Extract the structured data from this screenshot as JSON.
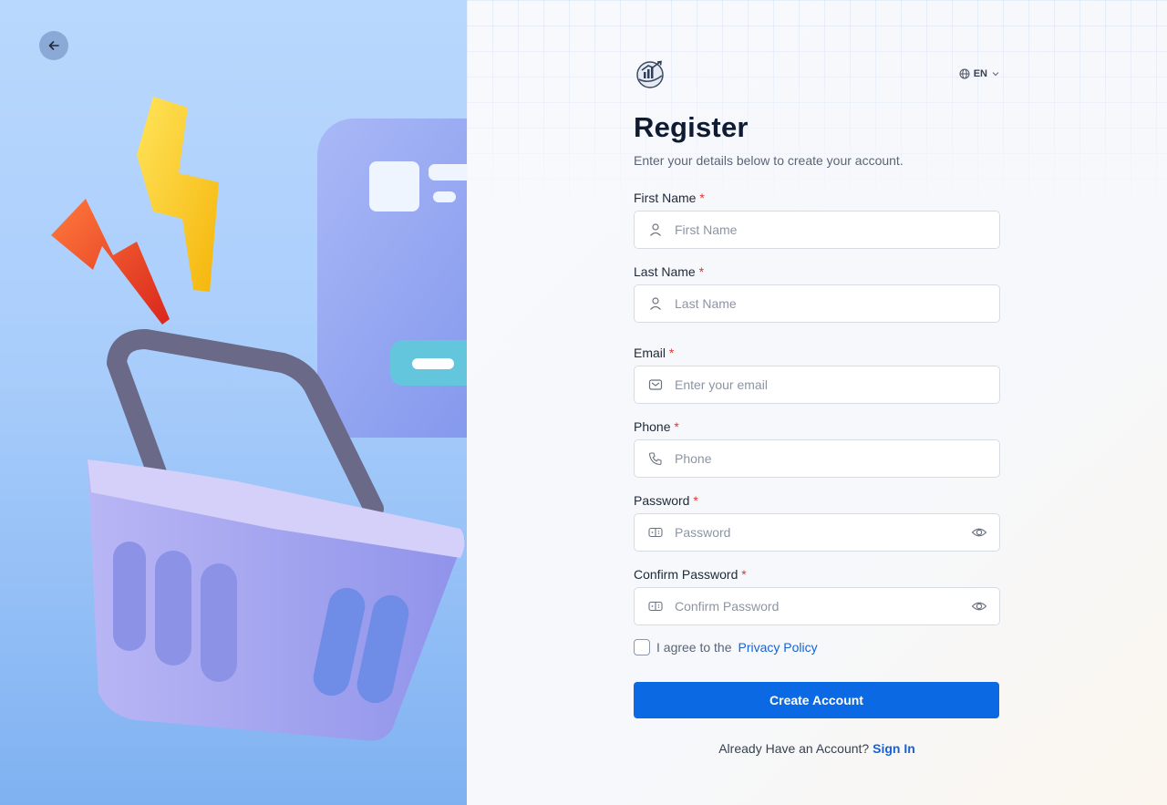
{
  "left_panel": {
    "back_icon": "arrow-left-icon",
    "illustration": "shopping-basket-with-card-and-lightning"
  },
  "header": {
    "logo_icon": "chart-globe-logo-icon",
    "language": {
      "label": "EN",
      "icon": "globe-icon",
      "chevron": "chevron-down-icon"
    }
  },
  "form": {
    "title": "Register",
    "subtitle": "Enter your details below to create your account.",
    "required_mark": "*",
    "fields": {
      "first_name": {
        "label": "First Name",
        "placeholder": "First Name",
        "value": "",
        "icon": "user-icon"
      },
      "last_name": {
        "label": "Last Name",
        "placeholder": "Last Name",
        "value": "",
        "icon": "user-icon"
      },
      "email": {
        "label": "Email",
        "placeholder": "Enter your email",
        "value": "",
        "icon": "mail-icon"
      },
      "phone": {
        "label": "Phone",
        "placeholder": "Phone",
        "value": "",
        "icon": "phone-icon"
      },
      "password": {
        "label": "Password",
        "placeholder": "Password",
        "value": "",
        "icon": "password-icon",
        "toggle_icon": "eye-icon"
      },
      "confirm_password": {
        "label": "Confirm Password",
        "placeholder": "Confirm Password",
        "value": "",
        "icon": "password-icon",
        "toggle_icon": "eye-icon"
      }
    },
    "agree": {
      "text": "I agree to the",
      "link": "Privacy Policy",
      "checked": false
    },
    "submit_label": "Create Account",
    "signin": {
      "text": "Already Have an Account?",
      "link": "Sign In"
    }
  },
  "colors": {
    "primary": "#0b6ae3",
    "link": "#1563d6",
    "required": "#e3342f",
    "heading": "#0f1b33"
  }
}
